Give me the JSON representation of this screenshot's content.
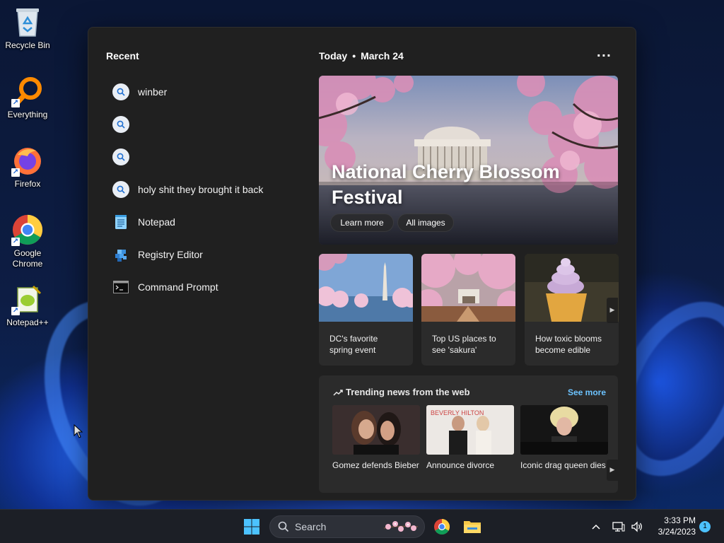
{
  "desktop": {
    "icons": [
      {
        "label": "Recycle Bin"
      },
      {
        "label": "Everything"
      },
      {
        "label": "Firefox"
      },
      {
        "label": "Google Chrome"
      },
      {
        "label": "Notepad++"
      }
    ]
  },
  "panel": {
    "recent_title": "Recent",
    "recent": [
      {
        "label": "winber",
        "icon": "search-icon"
      },
      {
        "label": "",
        "icon": "search-icon"
      },
      {
        "label": "",
        "icon": "search-icon"
      },
      {
        "label": "holy shit they brought it back",
        "icon": "search-icon"
      },
      {
        "label": "Notepad",
        "icon": "notepad-icon"
      },
      {
        "label": "Registry Editor",
        "icon": "registry-editor-icon"
      },
      {
        "label": "Command Prompt",
        "icon": "command-prompt-icon"
      }
    ],
    "today_label": "Today",
    "date_label": "March 24",
    "hero": {
      "title": "National Cherry Blossom Festival",
      "learn_more": "Learn more",
      "all_images": "All images"
    },
    "cards": [
      {
        "caption": "DC's favorite spring event"
      },
      {
        "caption": "Top US places to see 'sakura'"
      },
      {
        "caption": "How toxic blooms become edible"
      }
    ],
    "trending": {
      "title": "Trending news from the web",
      "see_more": "See more",
      "items": [
        {
          "caption": "Gomez defends Bieber"
        },
        {
          "caption": "Announce divorce"
        },
        {
          "caption": "Iconic drag queen dies"
        }
      ]
    }
  },
  "taskbar": {
    "search_placeholder": "Search",
    "time": "3:33 PM",
    "date": "3/24/2023",
    "notification_count": "1"
  },
  "colors": {
    "panel_bg": "#202020",
    "card_bg": "#2b2b2b",
    "accent_link": "#6cc3ff",
    "taskbar_bg": "#1c1f26"
  }
}
